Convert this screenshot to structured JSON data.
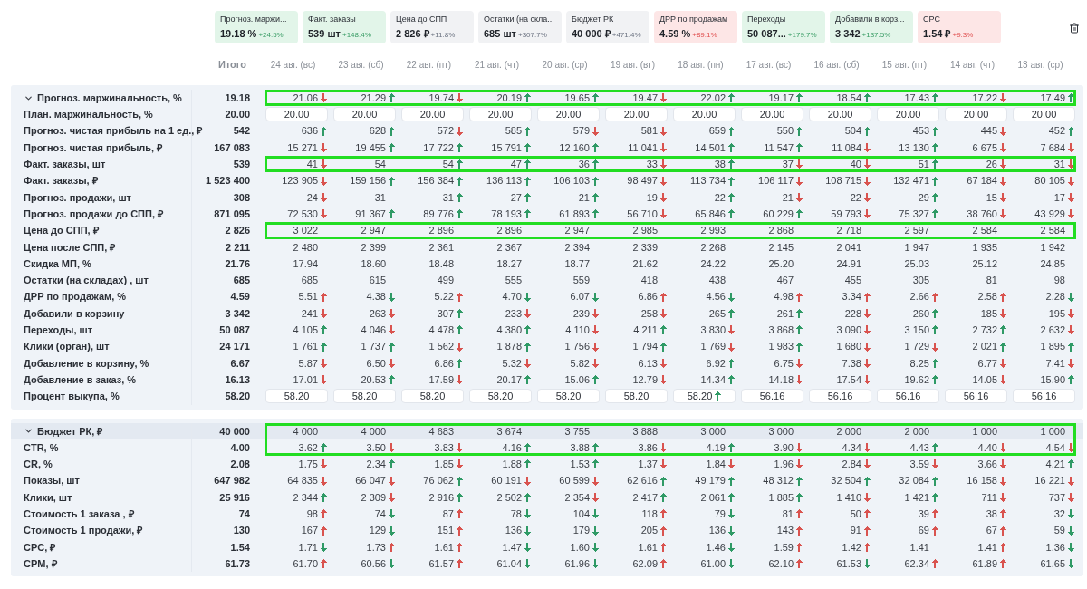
{
  "cards": [
    {
      "label": "Прогноз. маржи...",
      "value": "19.18 %",
      "change": "+24.5%",
      "kind": "good"
    },
    {
      "label": "Факт. заказы",
      "value": "539 шт",
      "change": "+148.4%",
      "kind": "good"
    },
    {
      "label": "Цена до СПП",
      "value": "2 826 ₽",
      "change": "+11.8%",
      "kind": "neutral"
    },
    {
      "label": "Остатки (на скла...",
      "value": "685 шт",
      "change": "+307.7%",
      "kind": "neutral"
    },
    {
      "label": "Бюджет РК",
      "value": "40 000 ₽",
      "change": "+471.4%",
      "kind": "neutral"
    },
    {
      "label": "ДРР по продажам",
      "value": "4.59 %",
      "change": "+89.1%",
      "kind": "bad"
    },
    {
      "label": "Переходы",
      "value": "50 087...",
      "change": "+179.7%",
      "kind": "good"
    },
    {
      "label": "Добавили в корз...",
      "value": "3 342",
      "change": "+137.5%",
      "kind": "good"
    },
    {
      "label": "CPC",
      "value": "1.54 ₽",
      "change": "+9.3%",
      "kind": "bad"
    }
  ],
  "total_header": "Итого",
  "dates": [
    "24 авг. (вс)",
    "23 авг. (сб)",
    "22 авг. (пт)",
    "21 авг. (чт)",
    "20 авг. (ср)",
    "19 авг. (вт)",
    "18 авг. (пн)",
    "17 авг. (вс)",
    "16 авг. (сб)",
    "15 авг. (пт)",
    "14 авг. (чт)",
    "13 авг. (ср)"
  ],
  "sections": [
    {
      "expanded": true,
      "hovered": false,
      "rows": [
        {
          "label": "Прогноз. маржинальность, %",
          "total": "19.18",
          "kind": "trend",
          "highlighted": true,
          "cells": [
            {
              "v": "21.06",
              "kind": "down",
              "color": "#d9534f"
            },
            {
              "v": "21.29",
              "kind": "up",
              "color": "#2f9a66"
            },
            {
              "v": "19.74",
              "kind": "down",
              "color": "#d9534f"
            },
            {
              "v": "20.19",
              "kind": "up",
              "color": "#2f9a66"
            },
            {
              "v": "19.65",
              "kind": "up",
              "color": "#2f9a66"
            },
            {
              "v": "19.47",
              "kind": "down",
              "color": "#d9534f"
            },
            {
              "v": "22.02",
              "kind": "up",
              "color": "#2f9a66"
            },
            {
              "v": "19.17",
              "kind": "up",
              "color": "#2f9a66"
            },
            {
              "v": "18.54",
              "kind": "up",
              "color": "#2f9a66"
            },
            {
              "v": "17.43",
              "kind": "up",
              "color": "#2f9a66"
            },
            {
              "v": "17.22",
              "kind": "down",
              "color": "#d9534f"
            },
            {
              "v": "17.49",
              "kind": "up",
              "color": "#2f9a66"
            }
          ]
        },
        {
          "label": "План. маржинальность, %",
          "total": "20.00",
          "kind": "input",
          "highlighted": false,
          "cells": [
            {
              "v": "20.00",
              "kind": "flat"
            },
            {
              "v": "20.00",
              "kind": "flat"
            },
            {
              "v": "20.00",
              "kind": "flat"
            },
            {
              "v": "20.00",
              "kind": "flat"
            },
            {
              "v": "20.00",
              "kind": "flat"
            },
            {
              "v": "20.00",
              "kind": "flat"
            },
            {
              "v": "20.00",
              "kind": "flat"
            },
            {
              "v": "20.00",
              "kind": "flat"
            },
            {
              "v": "20.00",
              "kind": "flat"
            },
            {
              "v": "20.00",
              "kind": "flat"
            },
            {
              "v": "20.00",
              "kind": "flat"
            },
            {
              "v": "20.00",
              "kind": "flat"
            }
          ]
        },
        {
          "label": "Прогноз. чистая прибыль на 1 ед., ₽",
          "total": "542",
          "kind": "trend",
          "highlighted": false,
          "cells": [
            {
              "v": "636",
              "kind": "up",
              "color": "#2f9a66"
            },
            {
              "v": "628",
              "kind": "up",
              "color": "#2f9a66"
            },
            {
              "v": "572",
              "kind": "down",
              "color": "#d9534f"
            },
            {
              "v": "585",
              "kind": "up",
              "color": "#2f9a66"
            },
            {
              "v": "579",
              "kind": "down",
              "color": "#d9534f"
            },
            {
              "v": "581",
              "kind": "down",
              "color": "#d9534f"
            },
            {
              "v": "659",
              "kind": "up",
              "color": "#2f9a66"
            },
            {
              "v": "550",
              "kind": "up",
              "color": "#2f9a66"
            },
            {
              "v": "504",
              "kind": "up",
              "color": "#2f9a66"
            },
            {
              "v": "453",
              "kind": "up",
              "color": "#2f9a66"
            },
            {
              "v": "445",
              "kind": "down",
              "color": "#d9534f"
            },
            {
              "v": "452",
              "kind": "up",
              "color": "#2f9a66"
            }
          ]
        },
        {
          "label": "Прогноз. чистая прибыль, ₽",
          "total": "167 083",
          "kind": "trend",
          "highlighted": false,
          "cells": [
            {
              "v": "15 271",
              "kind": "down",
              "color": "#d9534f"
            },
            {
              "v": "19 455",
              "kind": "up",
              "color": "#2f9a66"
            },
            {
              "v": "17 722",
              "kind": "up",
              "color": "#2f9a66"
            },
            {
              "v": "15 791",
              "kind": "up",
              "color": "#2f9a66"
            },
            {
              "v": "12 160",
              "kind": "up",
              "color": "#2f9a66"
            },
            {
              "v": "11 041",
              "kind": "down",
              "color": "#d9534f"
            },
            {
              "v": "14 501",
              "kind": "up",
              "color": "#2f9a66"
            },
            {
              "v": "11 547",
              "kind": "up",
              "color": "#2f9a66"
            },
            {
              "v": "11 084",
              "kind": "down",
              "color": "#d9534f"
            },
            {
              "v": "13 130",
              "kind": "up",
              "color": "#2f9a66"
            },
            {
              "v": "6 675",
              "kind": "down",
              "color": "#d9534f"
            },
            {
              "v": "7 684",
              "kind": "down",
              "color": "#d9534f"
            }
          ]
        },
        {
          "label": "Факт. заказы, шт",
          "total": "539",
          "kind": "trend",
          "highlighted": true,
          "cells": [
            {
              "v": "41",
              "kind": "down",
              "color": "#d9534f"
            },
            {
              "v": "54",
              "kind": "flat"
            },
            {
              "v": "54",
              "kind": "up",
              "color": "#2f9a66"
            },
            {
              "v": "47",
              "kind": "up",
              "color": "#2f9a66"
            },
            {
              "v": "36",
              "kind": "up",
              "color": "#2f9a66"
            },
            {
              "v": "33",
              "kind": "down",
              "color": "#d9534f"
            },
            {
              "v": "38",
              "kind": "up",
              "color": "#2f9a66"
            },
            {
              "v": "37",
              "kind": "down",
              "color": "#d9534f"
            },
            {
              "v": "40",
              "kind": "down",
              "color": "#d9534f"
            },
            {
              "v": "51",
              "kind": "up",
              "color": "#2f9a66"
            },
            {
              "v": "26",
              "kind": "down",
              "color": "#d9534f"
            },
            {
              "v": "31",
              "kind": "down",
              "color": "#d9534f"
            }
          ]
        },
        {
          "label": "Факт. заказы, ₽",
          "total": "1 523 400",
          "kind": "trend",
          "highlighted": false,
          "cells": [
            {
              "v": "123 905",
              "kind": "down",
              "color": "#d9534f"
            },
            {
              "v": "159 156",
              "kind": "up",
              "color": "#2f9a66"
            },
            {
              "v": "156 384",
              "kind": "up",
              "color": "#2f9a66"
            },
            {
              "v": "136 113",
              "kind": "up",
              "color": "#2f9a66"
            },
            {
              "v": "106 103",
              "kind": "up",
              "color": "#2f9a66"
            },
            {
              "v": "98 497",
              "kind": "down",
              "color": "#d9534f"
            },
            {
              "v": "113 734",
              "kind": "up",
              "color": "#2f9a66"
            },
            {
              "v": "106 117",
              "kind": "down",
              "color": "#d9534f"
            },
            {
              "v": "108 715",
              "kind": "down",
              "color": "#d9534f"
            },
            {
              "v": "132 471",
              "kind": "up",
              "color": "#2f9a66"
            },
            {
              "v": "67 184",
              "kind": "down",
              "color": "#d9534f"
            },
            {
              "v": "80 105",
              "kind": "down",
              "color": "#d9534f"
            }
          ]
        },
        {
          "label": "Прогноз. продажи, шт",
          "total": "308",
          "kind": "trend",
          "highlighted": false,
          "cells": [
            {
              "v": "24",
              "kind": "down",
              "color": "#d9534f"
            },
            {
              "v": "31",
              "kind": "flat"
            },
            {
              "v": "31",
              "kind": "up",
              "color": "#2f9a66"
            },
            {
              "v": "27",
              "kind": "up",
              "color": "#2f9a66"
            },
            {
              "v": "21",
              "kind": "up",
              "color": "#2f9a66"
            },
            {
              "v": "19",
              "kind": "down",
              "color": "#d9534f"
            },
            {
              "v": "22",
              "kind": "up",
              "color": "#2f9a66"
            },
            {
              "v": "21",
              "kind": "down",
              "color": "#d9534f"
            },
            {
              "v": "22",
              "kind": "down",
              "color": "#d9534f"
            },
            {
              "v": "29",
              "kind": "up",
              "color": "#2f9a66"
            },
            {
              "v": "15",
              "kind": "down",
              "color": "#d9534f"
            },
            {
              "v": "17",
              "kind": "down",
              "color": "#d9534f"
            }
          ]
        },
        {
          "label": "Прогноз. продажи до СПП, ₽",
          "total": "871 095",
          "kind": "trend",
          "highlighted": false,
          "cells": [
            {
              "v": "72 530",
              "kind": "down",
              "color": "#d9534f"
            },
            {
              "v": "91 367",
              "kind": "up",
              "color": "#2f9a66"
            },
            {
              "v": "89 776",
              "kind": "up",
              "color": "#2f9a66"
            },
            {
              "v": "78 193",
              "kind": "up",
              "color": "#2f9a66"
            },
            {
              "v": "61 893",
              "kind": "up",
              "color": "#2f9a66"
            },
            {
              "v": "56 710",
              "kind": "down",
              "color": "#d9534f"
            },
            {
              "v": "65 846",
              "kind": "up",
              "color": "#2f9a66"
            },
            {
              "v": "60 229",
              "kind": "up",
              "color": "#2f9a66"
            },
            {
              "v": "59 793",
              "kind": "down",
              "color": "#d9534f"
            },
            {
              "v": "75 327",
              "kind": "up",
              "color": "#2f9a66"
            },
            {
              "v": "38 760",
              "kind": "down",
              "color": "#d9534f"
            },
            {
              "v": "43 929",
              "kind": "down",
              "color": "#d9534f"
            }
          ]
        },
        {
          "label": "Цена до СПП, ₽",
          "total": "2 826",
          "kind": "plain",
          "highlighted": true,
          "values": [
            "3 022",
            "2 947",
            "2 896",
            "2 896",
            "2 947",
            "2 985",
            "2 993",
            "2 868",
            "2 718",
            "2 597",
            "2 584",
            "2 584"
          ]
        },
        {
          "label": "Цена после СПП, ₽",
          "total": "2 211",
          "kind": "plain",
          "highlighted": false,
          "values": [
            "2 480",
            "2 399",
            "2 361",
            "2 367",
            "2 394",
            "2 339",
            "2 268",
            "2 145",
            "2 041",
            "1 947",
            "1 935",
            "1 942"
          ]
        },
        {
          "label": "Скидка МП, %",
          "total": "21.76",
          "kind": "plain",
          "highlighted": false,
          "values": [
            "17.94",
            "18.60",
            "18.48",
            "18.27",
            "18.77",
            "21.62",
            "24.22",
            "25.20",
            "24.91",
            "25.03",
            "25.12",
            "24.85"
          ]
        },
        {
          "label": "Остатки (на складах) , шт",
          "total": "685",
          "kind": "plain",
          "highlighted": false,
          "values": [
            "685",
            "615",
            "499",
            "555",
            "559",
            "418",
            "438",
            "467",
            "455",
            "305",
            "81",
            "98"
          ]
        },
        {
          "label": "ДРР по продажам, %",
          "total": "4.59",
          "kind": "trend",
          "highlighted": false,
          "cells": [
            {
              "v": "5.51",
              "kind": "up",
              "color": "#d9534f"
            },
            {
              "v": "4.38",
              "kind": "down",
              "color": "#2f9a66"
            },
            {
              "v": "5.22",
              "kind": "up",
              "color": "#d9534f"
            },
            {
              "v": "4.70",
              "kind": "down",
              "color": "#2f9a66"
            },
            {
              "v": "6.07",
              "kind": "down",
              "color": "#2f9a66"
            },
            {
              "v": "6.86",
              "kind": "up",
              "color": "#d9534f"
            },
            {
              "v": "4.56",
              "kind": "down",
              "color": "#2f9a66"
            },
            {
              "v": "4.98",
              "kind": "up",
              "color": "#d9534f"
            },
            {
              "v": "3.34",
              "kind": "up",
              "color": "#d9534f"
            },
            {
              "v": "2.66",
              "kind": "up",
              "color": "#d9534f"
            },
            {
              "v": "2.58",
              "kind": "up",
              "color": "#d9534f"
            },
            {
              "v": "2.28",
              "kind": "down",
              "color": "#2f9a66"
            }
          ]
        },
        {
          "label": "Добавили в корзину",
          "total": "3 342",
          "kind": "trend",
          "highlighted": false,
          "cells": [
            {
              "v": "241",
              "kind": "down",
              "color": "#d9534f"
            },
            {
              "v": "263",
              "kind": "down",
              "color": "#d9534f"
            },
            {
              "v": "307",
              "kind": "up",
              "color": "#2f9a66"
            },
            {
              "v": "233",
              "kind": "down",
              "color": "#d9534f"
            },
            {
              "v": "239",
              "kind": "down",
              "color": "#d9534f"
            },
            {
              "v": "258",
              "kind": "down",
              "color": "#d9534f"
            },
            {
              "v": "265",
              "kind": "up",
              "color": "#2f9a66"
            },
            {
              "v": "261",
              "kind": "up",
              "color": "#2f9a66"
            },
            {
              "v": "228",
              "kind": "down",
              "color": "#d9534f"
            },
            {
              "v": "260",
              "kind": "up",
              "color": "#2f9a66"
            },
            {
              "v": "185",
              "kind": "down",
              "color": "#d9534f"
            },
            {
              "v": "195",
              "kind": "down",
              "color": "#d9534f"
            }
          ]
        },
        {
          "label": "Переходы, шт",
          "total": "50 087",
          "kind": "trend",
          "highlighted": false,
          "cells": [
            {
              "v": "4 105",
              "kind": "up",
              "color": "#2f9a66"
            },
            {
              "v": "4 046",
              "kind": "down",
              "color": "#d9534f"
            },
            {
              "v": "4 478",
              "kind": "up",
              "color": "#2f9a66"
            },
            {
              "v": "4 380",
              "kind": "up",
              "color": "#2f9a66"
            },
            {
              "v": "4 110",
              "kind": "down",
              "color": "#d9534f"
            },
            {
              "v": "4 211",
              "kind": "up",
              "color": "#2f9a66"
            },
            {
              "v": "3 830",
              "kind": "down",
              "color": "#d9534f"
            },
            {
              "v": "3 868",
              "kind": "up",
              "color": "#2f9a66"
            },
            {
              "v": "3 090",
              "kind": "down",
              "color": "#d9534f"
            },
            {
              "v": "3 150",
              "kind": "up",
              "color": "#2f9a66"
            },
            {
              "v": "2 732",
              "kind": "up",
              "color": "#2f9a66"
            },
            {
              "v": "2 632",
              "kind": "down",
              "color": "#d9534f"
            }
          ]
        },
        {
          "label": "Клики (орган), шт",
          "total": "24 171",
          "kind": "trend",
          "highlighted": false,
          "cells": [
            {
              "v": "1 761",
              "kind": "up",
              "color": "#2f9a66"
            },
            {
              "v": "1 737",
              "kind": "up",
              "color": "#2f9a66"
            },
            {
              "v": "1 562",
              "kind": "down",
              "color": "#d9534f"
            },
            {
              "v": "1 878",
              "kind": "up",
              "color": "#2f9a66"
            },
            {
              "v": "1 756",
              "kind": "down",
              "color": "#d9534f"
            },
            {
              "v": "1 794",
              "kind": "up",
              "color": "#2f9a66"
            },
            {
              "v": "1 769",
              "kind": "down",
              "color": "#d9534f"
            },
            {
              "v": "1 983",
              "kind": "up",
              "color": "#2f9a66"
            },
            {
              "v": "1 680",
              "kind": "down",
              "color": "#d9534f"
            },
            {
              "v": "1 729",
              "kind": "down",
              "color": "#d9534f"
            },
            {
              "v": "2 021",
              "kind": "up",
              "color": "#2f9a66"
            },
            {
              "v": "1 895",
              "kind": "up",
              "color": "#2f9a66"
            }
          ]
        },
        {
          "label": "Добавление в корзину, %",
          "total": "6.67",
          "kind": "trend",
          "highlighted": false,
          "cells": [
            {
              "v": "5.87",
              "kind": "down",
              "color": "#d9534f"
            },
            {
              "v": "6.50",
              "kind": "down",
              "color": "#d9534f"
            },
            {
              "v": "6.86",
              "kind": "up",
              "color": "#2f9a66"
            },
            {
              "v": "5.32",
              "kind": "down",
              "color": "#d9534f"
            },
            {
              "v": "5.82",
              "kind": "down",
              "color": "#d9534f"
            },
            {
              "v": "6.13",
              "kind": "down",
              "color": "#d9534f"
            },
            {
              "v": "6.92",
              "kind": "up",
              "color": "#2f9a66"
            },
            {
              "v": "6.75",
              "kind": "down",
              "color": "#d9534f"
            },
            {
              "v": "7.38",
              "kind": "down",
              "color": "#d9534f"
            },
            {
              "v": "8.25",
              "kind": "up",
              "color": "#2f9a66"
            },
            {
              "v": "6.77",
              "kind": "down",
              "color": "#d9534f"
            },
            {
              "v": "7.41",
              "kind": "down",
              "color": "#d9534f"
            }
          ]
        },
        {
          "label": "Добавление в заказ, %",
          "total": "16.13",
          "kind": "trend",
          "highlighted": false,
          "cells": [
            {
              "v": "17.01",
              "kind": "down",
              "color": "#d9534f"
            },
            {
              "v": "20.53",
              "kind": "up",
              "color": "#2f9a66"
            },
            {
              "v": "17.59",
              "kind": "down",
              "color": "#d9534f"
            },
            {
              "v": "20.17",
              "kind": "up",
              "color": "#2f9a66"
            },
            {
              "v": "15.06",
              "kind": "up",
              "color": "#2f9a66"
            },
            {
              "v": "12.79",
              "kind": "down",
              "color": "#d9534f"
            },
            {
              "v": "14.34",
              "kind": "up",
              "color": "#2f9a66"
            },
            {
              "v": "14.18",
              "kind": "down",
              "color": "#d9534f"
            },
            {
              "v": "17.54",
              "kind": "down",
              "color": "#d9534f"
            },
            {
              "v": "19.62",
              "kind": "up",
              "color": "#2f9a66"
            },
            {
              "v": "14.05",
              "kind": "down",
              "color": "#d9534f"
            },
            {
              "v": "15.90",
              "kind": "up",
              "color": "#2f9a66"
            }
          ]
        },
        {
          "label": "Процент выкупа, %",
          "total": "58.20",
          "kind": "input",
          "highlighted": false,
          "cells": [
            {
              "v": "58.20",
              "kind": "flat"
            },
            {
              "v": "58.20",
              "kind": "flat"
            },
            {
              "v": "58.20",
              "kind": "flat"
            },
            {
              "v": "58.20",
              "kind": "flat"
            },
            {
              "v": "58.20",
              "kind": "flat"
            },
            {
              "v": "58.20",
              "kind": "flat"
            },
            {
              "v": "58.20",
              "kind": "up",
              "color": "#2f9a66"
            },
            {
              "v": "56.16",
              "kind": "flat"
            },
            {
              "v": "56.16",
              "kind": "flat"
            },
            {
              "v": "56.16",
              "kind": "flat"
            },
            {
              "v": "56.16",
              "kind": "flat"
            },
            {
              "v": "56.16",
              "kind": "flat"
            }
          ]
        }
      ]
    },
    {
      "expanded": true,
      "hovered": true,
      "rows": [
        {
          "label": "Бюджет РК, ₽",
          "total": "40 000",
          "kind": "plain",
          "highlighted": true,
          "values": [
            "4 000",
            "4 000",
            "4 683",
            "3 674",
            "3 755",
            "3 888",
            "3 000",
            "3 000",
            "2 000",
            "2 000",
            "1 000",
            "1 000"
          ]
        },
        {
          "label": "CTR, %",
          "total": "4.00",
          "kind": "trend",
          "highlighted": true,
          "cells": [
            {
              "v": "3.62",
              "kind": "up",
              "color": "#2f9a66"
            },
            {
              "v": "3.50",
              "kind": "down",
              "color": "#d9534f"
            },
            {
              "v": "3.83",
              "kind": "down",
              "color": "#d9534f"
            },
            {
              "v": "4.16",
              "kind": "up",
              "color": "#2f9a66"
            },
            {
              "v": "3.88",
              "kind": "up",
              "color": "#2f9a66"
            },
            {
              "v": "3.86",
              "kind": "down",
              "color": "#d9534f"
            },
            {
              "v": "4.19",
              "kind": "up",
              "color": "#2f9a66"
            },
            {
              "v": "3.90",
              "kind": "down",
              "color": "#d9534f"
            },
            {
              "v": "4.34",
              "kind": "down",
              "color": "#d9534f"
            },
            {
              "v": "4.43",
              "kind": "up",
              "color": "#2f9a66"
            },
            {
              "v": "4.40",
              "kind": "down",
              "color": "#d9534f"
            },
            {
              "v": "4.54",
              "kind": "down",
              "color": "#d9534f"
            }
          ]
        },
        {
          "label": "CR, %",
          "total": "2.08",
          "kind": "trend",
          "highlighted": false,
          "cells": [
            {
              "v": "1.75",
              "kind": "down",
              "color": "#d9534f"
            },
            {
              "v": "2.34",
              "kind": "up",
              "color": "#2f9a66"
            },
            {
              "v": "1.85",
              "kind": "down",
              "color": "#d9534f"
            },
            {
              "v": "1.88",
              "kind": "up",
              "color": "#2f9a66"
            },
            {
              "v": "1.53",
              "kind": "up",
              "color": "#2f9a66"
            },
            {
              "v": "1.37",
              "kind": "down",
              "color": "#d9534f"
            },
            {
              "v": "1.84",
              "kind": "down",
              "color": "#d9534f"
            },
            {
              "v": "1.96",
              "kind": "down",
              "color": "#d9534f"
            },
            {
              "v": "2.84",
              "kind": "down",
              "color": "#d9534f"
            },
            {
              "v": "3.59",
              "kind": "down",
              "color": "#d9534f"
            },
            {
              "v": "3.66",
              "kind": "down",
              "color": "#d9534f"
            },
            {
              "v": "4.21",
              "kind": "up",
              "color": "#2f9a66"
            }
          ]
        },
        {
          "label": "Показы, шт",
          "total": "647 982",
          "kind": "trend",
          "highlighted": false,
          "cells": [
            {
              "v": "64 835",
              "kind": "down",
              "color": "#d9534f"
            },
            {
              "v": "66 047",
              "kind": "down",
              "color": "#d9534f"
            },
            {
              "v": "76 062",
              "kind": "up",
              "color": "#2f9a66"
            },
            {
              "v": "60 191",
              "kind": "down",
              "color": "#d9534f"
            },
            {
              "v": "60 599",
              "kind": "down",
              "color": "#d9534f"
            },
            {
              "v": "62 616",
              "kind": "up",
              "color": "#2f9a66"
            },
            {
              "v": "49 179",
              "kind": "up",
              "color": "#2f9a66"
            },
            {
              "v": "48 312",
              "kind": "up",
              "color": "#2f9a66"
            },
            {
              "v": "32 504",
              "kind": "up",
              "color": "#2f9a66"
            },
            {
              "v": "32 084",
              "kind": "up",
              "color": "#2f9a66"
            },
            {
              "v": "16 158",
              "kind": "down",
              "color": "#d9534f"
            },
            {
              "v": "16 221",
              "kind": "down",
              "color": "#d9534f"
            }
          ]
        },
        {
          "label": "Клики, шт",
          "total": "25 916",
          "kind": "trend",
          "highlighted": false,
          "cells": [
            {
              "v": "2 344",
              "kind": "up",
              "color": "#2f9a66"
            },
            {
              "v": "2 309",
              "kind": "down",
              "color": "#d9534f"
            },
            {
              "v": "2 916",
              "kind": "up",
              "color": "#2f9a66"
            },
            {
              "v": "2 502",
              "kind": "up",
              "color": "#2f9a66"
            },
            {
              "v": "2 354",
              "kind": "down",
              "color": "#d9534f"
            },
            {
              "v": "2 417",
              "kind": "up",
              "color": "#2f9a66"
            },
            {
              "v": "2 061",
              "kind": "up",
              "color": "#2f9a66"
            },
            {
              "v": "1 885",
              "kind": "up",
              "color": "#2f9a66"
            },
            {
              "v": "1 410",
              "kind": "down",
              "color": "#d9534f"
            },
            {
              "v": "1 421",
              "kind": "up",
              "color": "#2f9a66"
            },
            {
              "v": "711",
              "kind": "down",
              "color": "#d9534f"
            },
            {
              "v": "737",
              "kind": "down",
              "color": "#d9534f"
            }
          ]
        },
        {
          "label": "Стоимость 1 заказа , ₽",
          "total": "74",
          "kind": "trend",
          "highlighted": false,
          "cells": [
            {
              "v": "98",
              "kind": "up",
              "color": "#d9534f"
            },
            {
              "v": "74",
              "kind": "down",
              "color": "#2f9a66"
            },
            {
              "v": "87",
              "kind": "up",
              "color": "#d9534f"
            },
            {
              "v": "78",
              "kind": "down",
              "color": "#2f9a66"
            },
            {
              "v": "104",
              "kind": "down",
              "color": "#2f9a66"
            },
            {
              "v": "118",
              "kind": "up",
              "color": "#d9534f"
            },
            {
              "v": "79",
              "kind": "down",
              "color": "#2f9a66"
            },
            {
              "v": "81",
              "kind": "up",
              "color": "#d9534f"
            },
            {
              "v": "50",
              "kind": "up",
              "color": "#d9534f"
            },
            {
              "v": "39",
              "kind": "up",
              "color": "#d9534f"
            },
            {
              "v": "38",
              "kind": "up",
              "color": "#d9534f"
            },
            {
              "v": "32",
              "kind": "down",
              "color": "#2f9a66"
            }
          ]
        },
        {
          "label": "Стоимость 1 продажи, ₽",
          "total": "130",
          "kind": "trend",
          "highlighted": false,
          "cells": [
            {
              "v": "167",
              "kind": "up",
              "color": "#d9534f"
            },
            {
              "v": "129",
              "kind": "down",
              "color": "#2f9a66"
            },
            {
              "v": "151",
              "kind": "up",
              "color": "#d9534f"
            },
            {
              "v": "136",
              "kind": "down",
              "color": "#2f9a66"
            },
            {
              "v": "179",
              "kind": "down",
              "color": "#2f9a66"
            },
            {
              "v": "205",
              "kind": "up",
              "color": "#d9534f"
            },
            {
              "v": "136",
              "kind": "down",
              "color": "#2f9a66"
            },
            {
              "v": "143",
              "kind": "up",
              "color": "#d9534f"
            },
            {
              "v": "91",
              "kind": "up",
              "color": "#d9534f"
            },
            {
              "v": "69",
              "kind": "up",
              "color": "#d9534f"
            },
            {
              "v": "67",
              "kind": "up",
              "color": "#d9534f"
            },
            {
              "v": "59",
              "kind": "down",
              "color": "#2f9a66"
            }
          ]
        },
        {
          "label": "CPC, ₽",
          "total": "1.54",
          "kind": "trend",
          "highlighted": false,
          "cells": [
            {
              "v": "1.71",
              "kind": "down",
              "color": "#2f9a66"
            },
            {
              "v": "1.73",
              "kind": "up",
              "color": "#d9534f"
            },
            {
              "v": "1.61",
              "kind": "up",
              "color": "#d9534f"
            },
            {
              "v": "1.47",
              "kind": "down",
              "color": "#2f9a66"
            },
            {
              "v": "1.60",
              "kind": "down",
              "color": "#2f9a66"
            },
            {
              "v": "1.61",
              "kind": "up",
              "color": "#d9534f"
            },
            {
              "v": "1.46",
              "kind": "down",
              "color": "#2f9a66"
            },
            {
              "v": "1.59",
              "kind": "up",
              "color": "#d9534f"
            },
            {
              "v": "1.42",
              "kind": "up",
              "color": "#d9534f"
            },
            {
              "v": "1.41",
              "kind": "flat"
            },
            {
              "v": "1.41",
              "kind": "up",
              "color": "#d9534f"
            },
            {
              "v": "1.36",
              "kind": "down",
              "color": "#2f9a66"
            }
          ]
        },
        {
          "label": "CPM, ₽",
          "total": "61.73",
          "kind": "trend",
          "highlighted": false,
          "cells": [
            {
              "v": "61.70",
              "kind": "up",
              "color": "#d9534f"
            },
            {
              "v": "60.56",
              "kind": "down",
              "color": "#2f9a66"
            },
            {
              "v": "61.57",
              "kind": "up",
              "color": "#d9534f"
            },
            {
              "v": "61.04",
              "kind": "down",
              "color": "#2f9a66"
            },
            {
              "v": "61.96",
              "kind": "down",
              "color": "#2f9a66"
            },
            {
              "v": "62.09",
              "kind": "up",
              "color": "#d9534f"
            },
            {
              "v": "61.00",
              "kind": "down",
              "color": "#2f9a66"
            },
            {
              "v": "62.10",
              "kind": "up",
              "color": "#d9534f"
            },
            {
              "v": "61.53",
              "kind": "down",
              "color": "#2f9a66"
            },
            {
              "v": "62.34",
              "kind": "up",
              "color": "#d9534f"
            },
            {
              "v": "61.89",
              "kind": "up",
              "color": "#d9534f"
            },
            {
              "v": "61.65",
              "kind": "down",
              "color": "#2f9a66"
            }
          ]
        }
      ]
    }
  ]
}
